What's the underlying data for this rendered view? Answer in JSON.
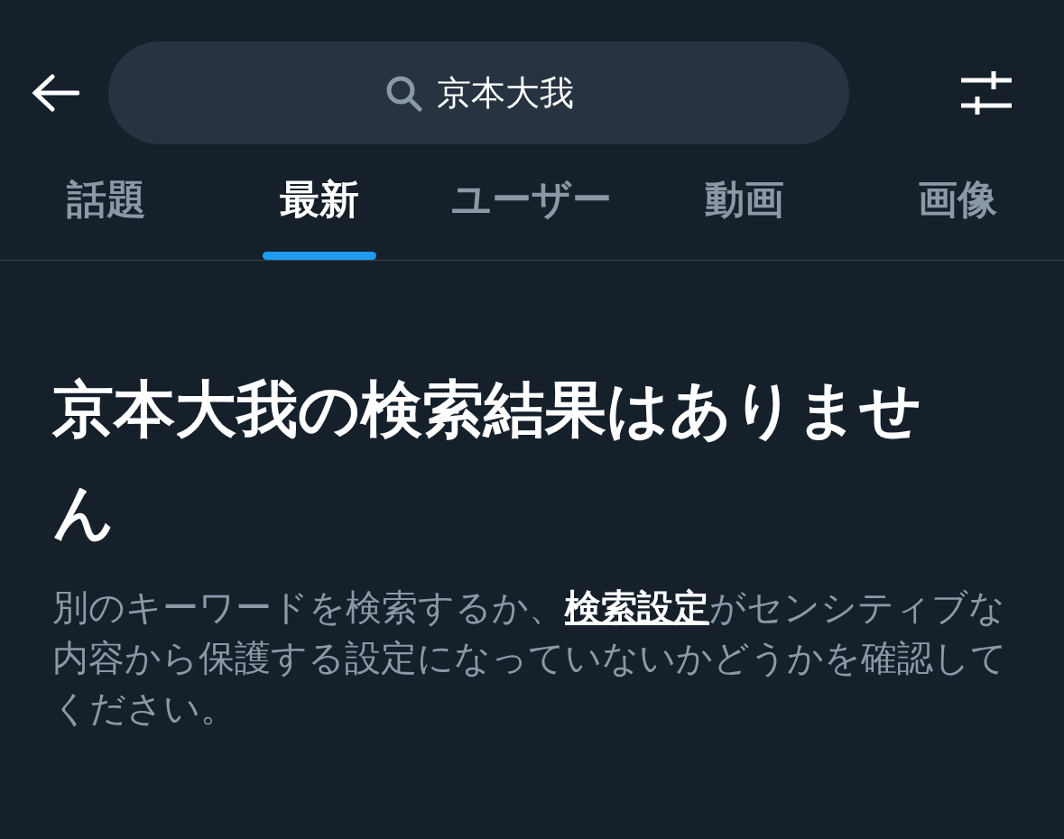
{
  "search": {
    "value": "京本大我"
  },
  "tabs": [
    {
      "label": "話題",
      "selected": false
    },
    {
      "label": "最新",
      "selected": true
    },
    {
      "label": "ユーザー",
      "selected": false
    },
    {
      "label": "動画",
      "selected": false
    },
    {
      "label": "画像",
      "selected": false
    }
  ],
  "empty_state": {
    "title": "京本大我の検索結果はありません",
    "message_before": "別のキーワードを検索するか、",
    "message_link": "検索設定",
    "message_after": "がセンシティブな内容から保護する設定になっていないかどうかを確認してください。"
  }
}
